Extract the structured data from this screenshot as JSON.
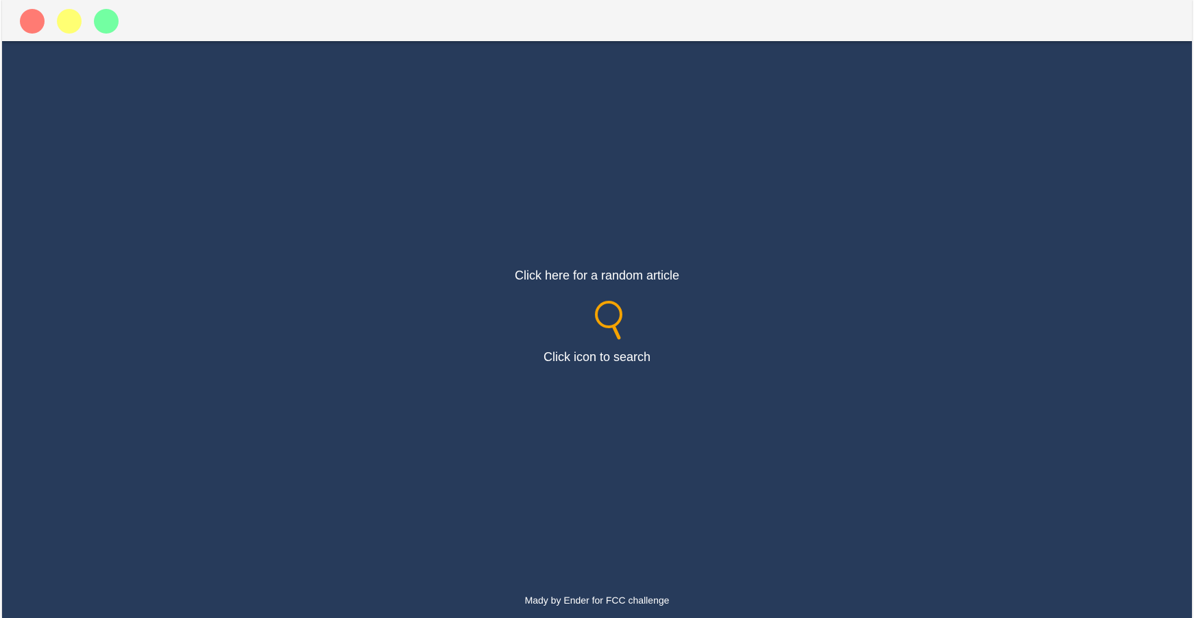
{
  "window": {
    "buttons": [
      {
        "name": "close",
        "color": "#ff7b73"
      },
      {
        "name": "minimize",
        "color": "#ffff73"
      },
      {
        "name": "maximize",
        "color": "#73ffa2"
      }
    ],
    "background_color": "#273b5b",
    "titlebar_color": "#f5f5f5"
  },
  "main": {
    "random_article_label": "Click here for a random article",
    "search_icon": "search-icon",
    "search_icon_color": "#f5a300",
    "search_hint": "Click icon to search"
  },
  "footer": {
    "credit": "Mady by Ender for FCC challenge"
  }
}
